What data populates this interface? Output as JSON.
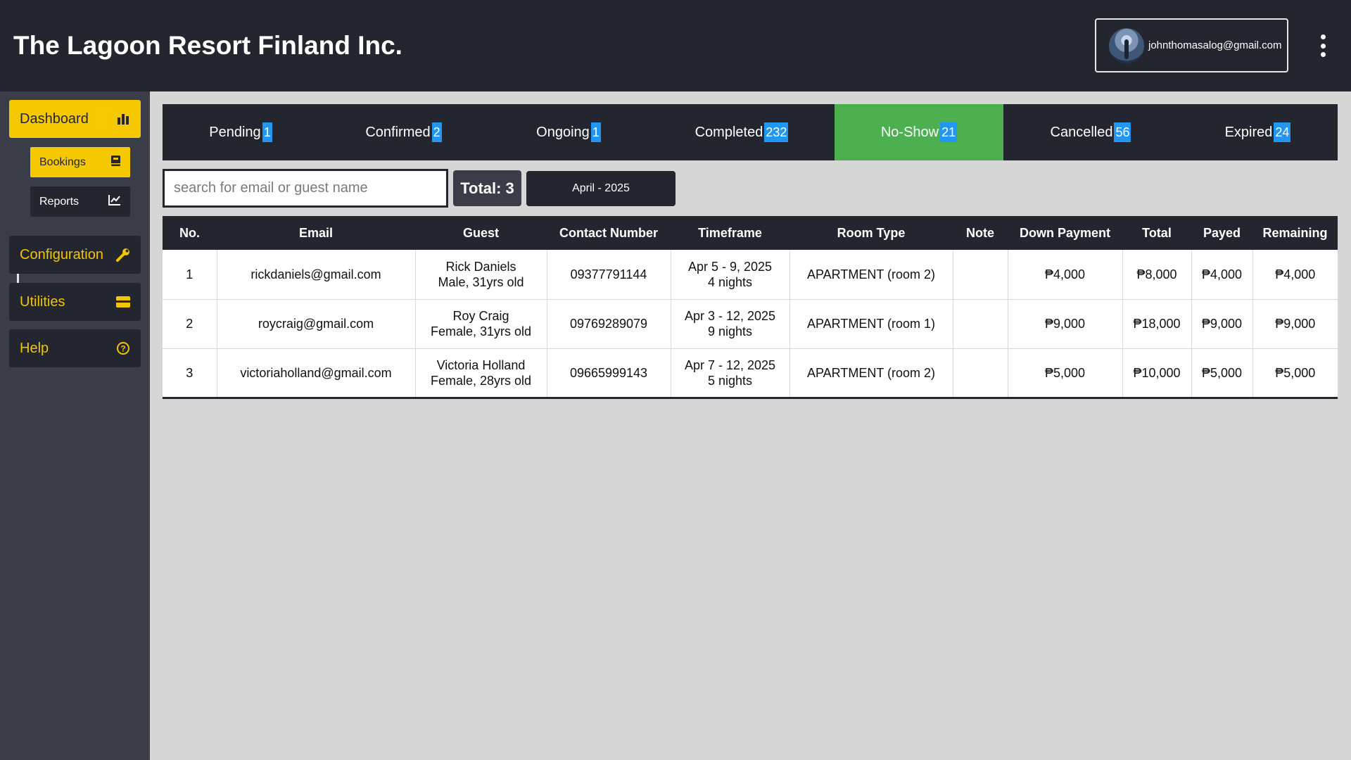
{
  "header": {
    "title": "The Lagoon Resort Finland Inc.",
    "user_email": "johnthomasalog@gmail.com"
  },
  "sidebar": {
    "dashboard": "Dashboard",
    "bookings": "Bookings",
    "reports": "Reports",
    "configuration": "Configuration",
    "utilities": "Utilities",
    "help": "Help"
  },
  "tabs": [
    {
      "label": "Pending",
      "count": "1"
    },
    {
      "label": "Confirmed",
      "count": "2"
    },
    {
      "label": "Ongoing",
      "count": "1"
    },
    {
      "label": "Completed",
      "count": "232"
    },
    {
      "label": "No-Show",
      "count": "21"
    },
    {
      "label": "Cancelled",
      "count": "56"
    },
    {
      "label": "Expired",
      "count": "24"
    }
  ],
  "active_tab": "No-Show",
  "search": {
    "placeholder": "search for email or guest name",
    "value": ""
  },
  "total_label": "Total: 3",
  "month_label": "April - 2025",
  "table": {
    "headers": [
      "No.",
      "Email",
      "Guest",
      "Contact Number",
      "Timeframe",
      "Room Type",
      "Note",
      "Down Payment",
      "Total",
      "Payed",
      "Remaining"
    ],
    "rows": [
      {
        "no": "1",
        "email": "rickdaniels@gmail.com",
        "guest_name": "Rick Daniels",
        "guest_info": "Male, 31yrs old",
        "contact": "09377791144",
        "dates": "Apr 5 - 9, 2025",
        "nights": "4 nights",
        "room": "APARTMENT (room 2)",
        "note": "",
        "down": "₱4,000",
        "total": "₱8,000",
        "payed": "₱4,000",
        "remaining": "₱4,000"
      },
      {
        "no": "2",
        "email": "roycraig@gmail.com",
        "guest_name": "Roy Craig",
        "guest_info": "Female, 31yrs old",
        "contact": "09769289079",
        "dates": "Apr 3 - 12, 2025",
        "nights": "9 nights",
        "room": "APARTMENT (room 1)",
        "note": "",
        "down": "₱9,000",
        "total": "₱18,000",
        "payed": "₱9,000",
        "remaining": "₱9,000"
      },
      {
        "no": "3",
        "email": "victoriaholland@gmail.com",
        "guest_name": "Victoria Holland",
        "guest_info": "Female, 28yrs old",
        "contact": "09665999143",
        "dates": "Apr 7 - 12, 2025",
        "nights": "5 nights",
        "room": "APARTMENT (room 2)",
        "note": "",
        "down": "₱5,000",
        "total": "₱10,000",
        "payed": "₱5,000",
        "remaining": "₱5,000"
      }
    ]
  },
  "colors": {
    "header_bg": "#23262f",
    "sidebar_bg": "#3a3d48",
    "accent_yellow": "#f5c800",
    "active_tab_green": "#4caf50",
    "badge_blue": "#2196f3",
    "content_bg": "#d6d6d6"
  },
  "icons": {
    "dashboard": "bar-chart-icon",
    "bookings": "book-icon",
    "reports": "line-chart-icon",
    "configuration": "wrench-icon",
    "utilities": "credit-card-icon",
    "help": "question-circle-icon",
    "menu": "kebab-menu-icon"
  }
}
